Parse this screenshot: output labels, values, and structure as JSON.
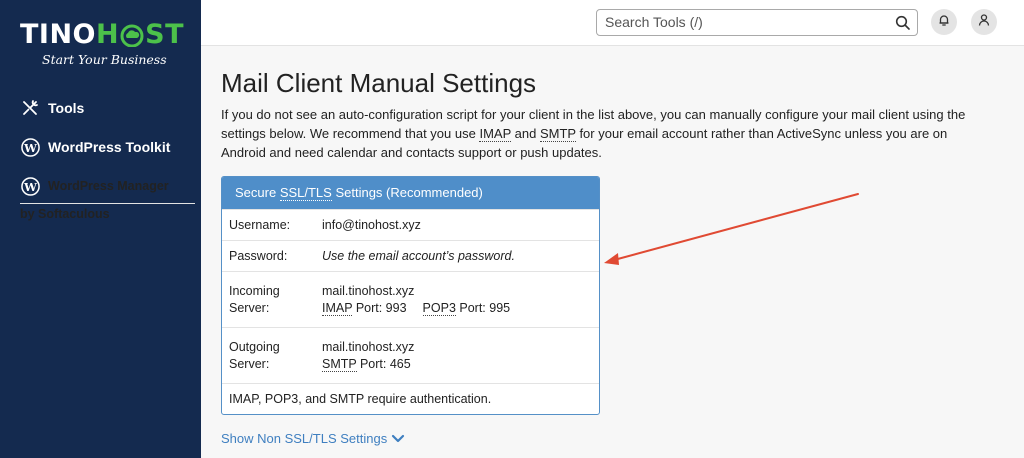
{
  "brand": {
    "name_part1": "TINO",
    "name_part2": "H",
    "name_part3": "ST",
    "tagline": "Start Your Business",
    "colors": {
      "sidebar": "#142a4f",
      "accent_green": "#4cc14a",
      "panel_header": "#4f8ec9",
      "link": "#3f7fc0",
      "arrow": "#e04a33"
    }
  },
  "sidebar": {
    "items": [
      {
        "label": "Tools",
        "icon": "tools-icon"
      },
      {
        "label": "WordPress Toolkit",
        "icon": "wordpress-icon"
      },
      {
        "label": "WordPress Manager",
        "label_line2": "by Softaculous",
        "icon": "wordpress-icon"
      }
    ]
  },
  "header": {
    "search_placeholder": "Search Tools (/)",
    "icons": [
      "search-icon",
      "bell-icon",
      "user-icon"
    ]
  },
  "main": {
    "title": "Mail Client Manual Settings",
    "intro_part1": "If you do not see an auto-configuration script for your client in the list above, you can manually configure your mail client using the settings below. We recommend that you use ",
    "intro_imap": "IMAP",
    "intro_and": " and ",
    "intro_smtp": "SMTP",
    "intro_part2": " for your email account rather than ActiveSync unless you are on Android and need calendar and contacts support or push updates.",
    "panel": {
      "head_prefix": "Secure ",
      "head_abbr": "SSL/TLS",
      "head_suffix": " Settings (Recommended)",
      "username_label": "Username:",
      "username_value": "info@tinohost.xyz",
      "password_label": "Password:",
      "password_value": "Use the email account’s password.",
      "incoming_label_1": "Incoming",
      "incoming_label_2": "Server:",
      "incoming_host": "mail.tinohost.xyz",
      "imap_abbr": "IMAP",
      "imap_port_text": " Port: 993",
      "pop3_abbr": "POP3",
      "pop3_port_text": " Port: 995",
      "outgoing_label_1": "Outgoing",
      "outgoing_label_2": "Server:",
      "outgoing_host": "mail.tinohost.xyz",
      "smtp_abbr": "SMTP",
      "smtp_port_text": " Port: 465",
      "auth_note": "IMAP, POP3, and SMTP require authentication."
    },
    "show_non_ssl": "Show Non SSL/TLS Settings"
  }
}
